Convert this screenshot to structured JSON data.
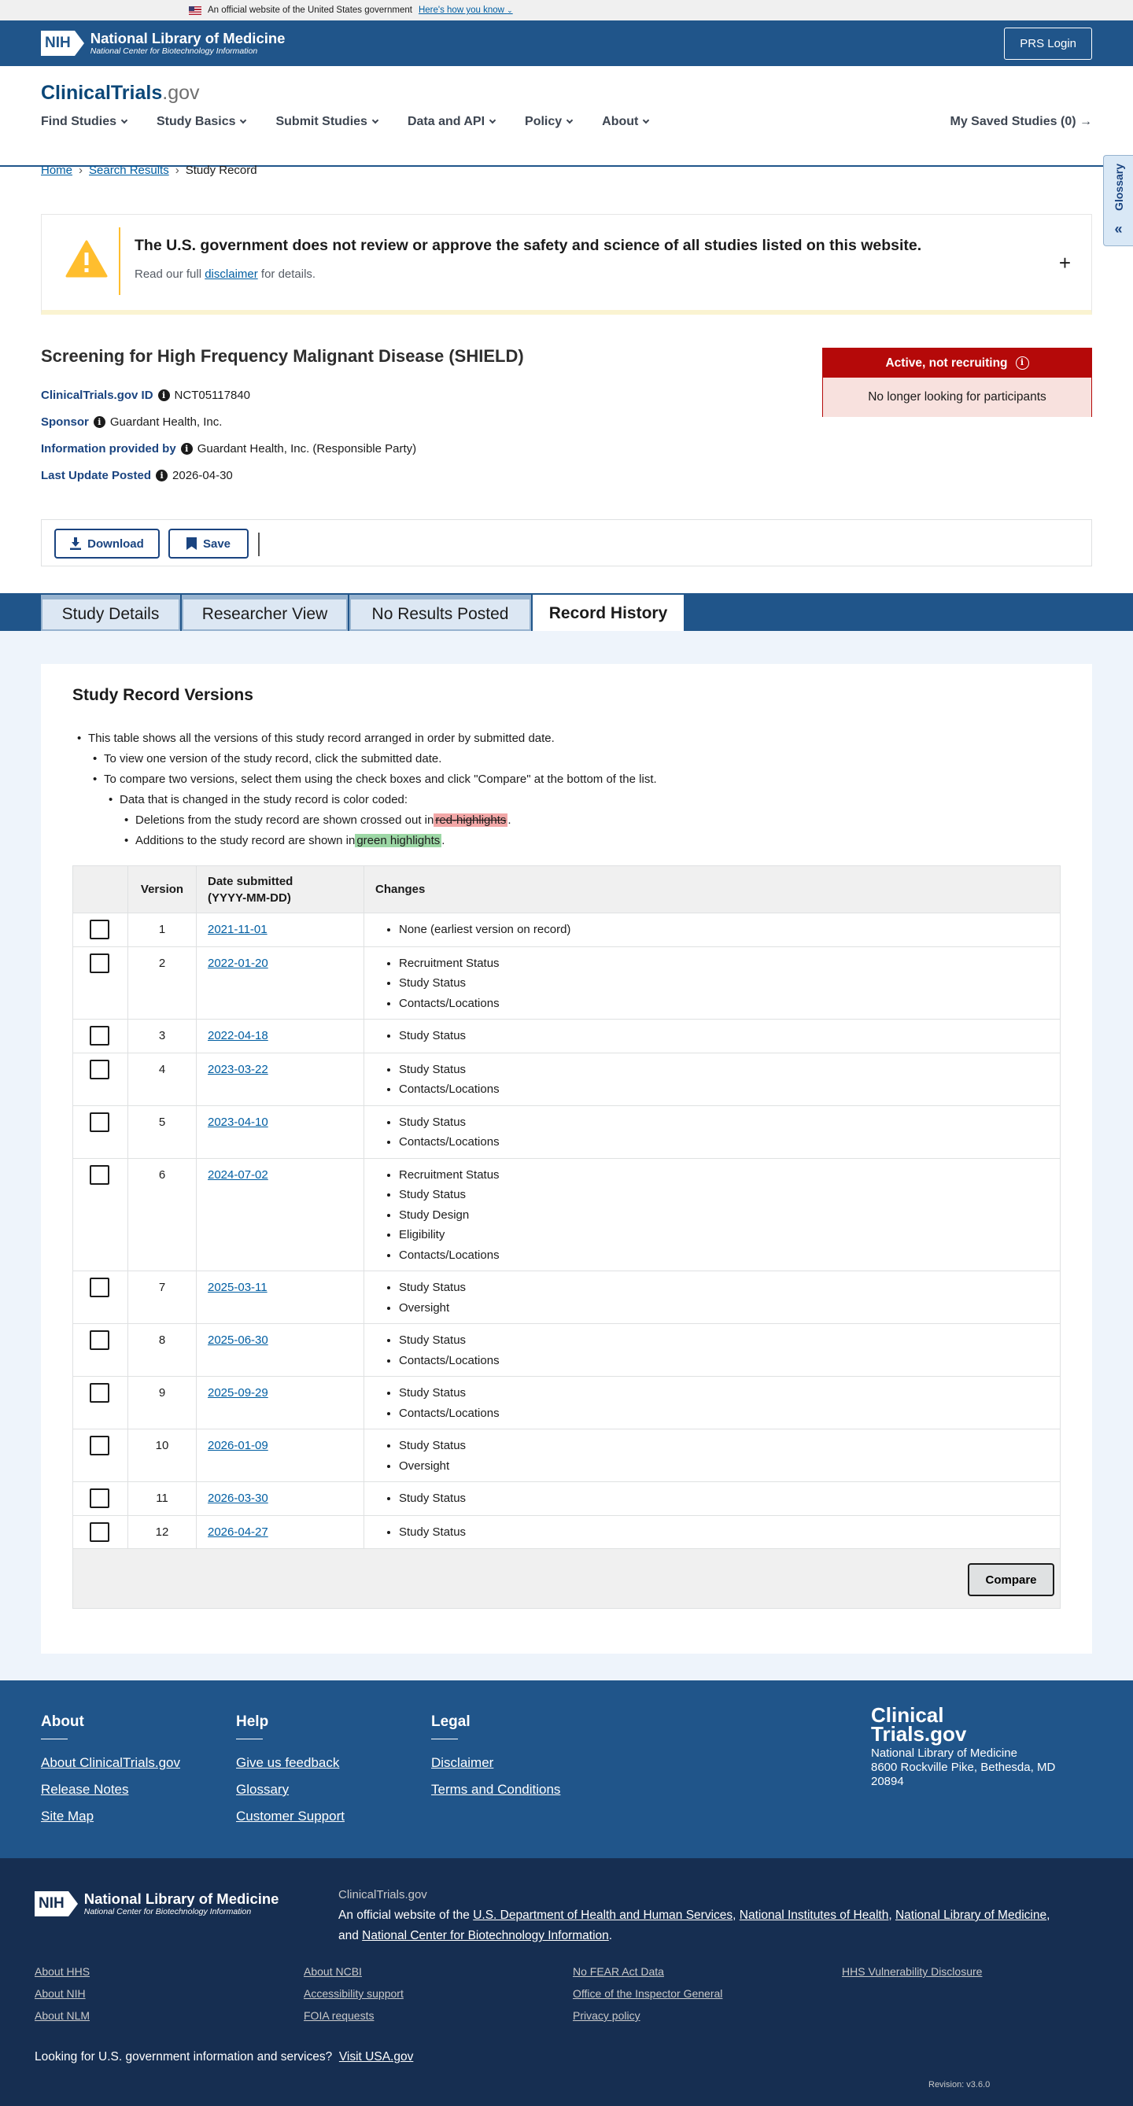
{
  "banner": {
    "text": "An official website of the United States government",
    "link": "Here's how you know"
  },
  "nih": {
    "short": "NIH",
    "name": "National Library of Medicine",
    "sub": "National Center for Biotechnology Information",
    "login": "PRS Login"
  },
  "brand": {
    "main": "ClinicalTrials",
    "gov": ".gov"
  },
  "nav": {
    "items": [
      "Find Studies",
      "Study Basics",
      "Submit Studies",
      "Data and API",
      "Policy",
      "About"
    ],
    "saved": "My Saved Studies (0)"
  },
  "breadcrumb": {
    "home": "Home",
    "results": "Search Results",
    "current": "Study Record"
  },
  "glossary": "Glossary",
  "alert": {
    "heading": "The U.S. government does not review or approve the safety and science of all studies listed on this website.",
    "pre": "Read our full ",
    "link": "disclaimer",
    "post": " for details."
  },
  "study": {
    "title": "Screening for High Frequency Malignant Disease (SHIELD)",
    "id_label": "ClinicalTrials.gov ID",
    "id": "NCT05117840",
    "sponsor_label": "Sponsor",
    "sponsor": "Guardant Health, Inc.",
    "info_label": "Information provided by",
    "info": "Guardant Health, Inc. (Responsible Party)",
    "update_label": "Last Update Posted",
    "update": "2026-04-30"
  },
  "status": {
    "label": "Active, not recruiting",
    "sub": "No longer looking for participants",
    "color": "#b50909"
  },
  "actions": {
    "download": "Download",
    "save": "Save"
  },
  "tabs": [
    "Study Details",
    "Researcher View",
    "No Results Posted",
    "Record History"
  ],
  "versions": {
    "heading": "Study Record Versions",
    "intro": "This table shows all the versions of this study record arranged in order by submitted date.",
    "view": "To view one version of the study record, click the submitted date.",
    "compare": "To compare two versions, select them using the check boxes and click \"Compare\" at the bottom of the list.",
    "color": "Data that is changed in the study record is color coded:",
    "del_pre": "Deletions from the study record are shown crossed out in ",
    "del_hl": "red-highlights",
    "del_post": ".",
    "add_pre": "Additions to the study record are shown in ",
    "add_hl": "green highlights",
    "add_post": ".",
    "col_version": "Version",
    "col_date1": "Date submitted",
    "col_date2": "(YYYY-MM-DD)",
    "col_changes": "Changes",
    "compare_btn": "Compare",
    "rows": [
      {
        "v": "1",
        "d": "2021-11-01",
        "c": [
          "None (earliest version on record)"
        ]
      },
      {
        "v": "2",
        "d": "2022-01-20",
        "c": [
          "Recruitment Status",
          "Study Status",
          "Contacts/Locations"
        ]
      },
      {
        "v": "3",
        "d": "2022-04-18",
        "c": [
          "Study Status"
        ]
      },
      {
        "v": "4",
        "d": "2023-03-22",
        "c": [
          "Study Status",
          "Contacts/Locations"
        ]
      },
      {
        "v": "5",
        "d": "2023-04-10",
        "c": [
          "Study Status",
          "Contacts/Locations"
        ]
      },
      {
        "v": "6",
        "d": "2024-07-02",
        "c": [
          "Recruitment Status",
          "Study Status",
          "Study Design",
          "Eligibility",
          "Contacts/Locations"
        ]
      },
      {
        "v": "7",
        "d": "2025-03-11",
        "c": [
          "Study Status",
          "Oversight"
        ]
      },
      {
        "v": "8",
        "d": "2025-06-30",
        "c": [
          "Study Status",
          "Contacts/Locations"
        ]
      },
      {
        "v": "9",
        "d": "2025-09-29",
        "c": [
          "Study Status",
          "Contacts/Locations"
        ]
      },
      {
        "v": "10",
        "d": "2026-01-09",
        "c": [
          "Study Status",
          "Oversight"
        ]
      },
      {
        "v": "11",
        "d": "2026-03-30",
        "c": [
          "Study Status"
        ]
      },
      {
        "v": "12",
        "d": "2026-04-27",
        "c": [
          "Study Status"
        ]
      }
    ]
  },
  "footer": {
    "about": {
      "title": "About",
      "links": [
        "About ClinicalTrials.gov",
        "Release Notes",
        "Site Map"
      ]
    },
    "help": {
      "title": "Help",
      "links": [
        "Give us feedback",
        "Glossary",
        "Customer Support"
      ]
    },
    "legal": {
      "title": "Legal",
      "links": [
        "Disclaimer",
        "Terms and Conditions"
      ]
    },
    "logo1": "Clinical",
    "logo2": "Trials.gov",
    "addr1": "National Library of Medicine",
    "addr2": "8600 Rockville Pike, Bethesda, MD",
    "addr3": "20894"
  },
  "footer2": {
    "ct": "ClinicalTrials.gov",
    "official": "An official website of the ",
    "hhs": "U.S. Department of Health and Human Services",
    "comma1": ", ",
    "nih": "National Institutes of Health",
    "comma2": ", ",
    "nlm": "National Library of Medicine",
    "comma3": ",",
    "and": "and ",
    "ncbi": "National Center for Biotechnology Information",
    "dot": ".",
    "links": [
      "About HHS",
      "About NIH",
      "About NLM",
      "About NCBI",
      "Accessibility support",
      "FOIA requests",
      "No FEAR Act Data",
      "Office of the Inspector General",
      "Privacy policy",
      "HHS Vulnerability Disclosure"
    ],
    "usa_text": "Looking for U.S. government information and services?",
    "usa_link": "Visit USA.gov",
    "revision": "Revision: v3.6.0"
  }
}
